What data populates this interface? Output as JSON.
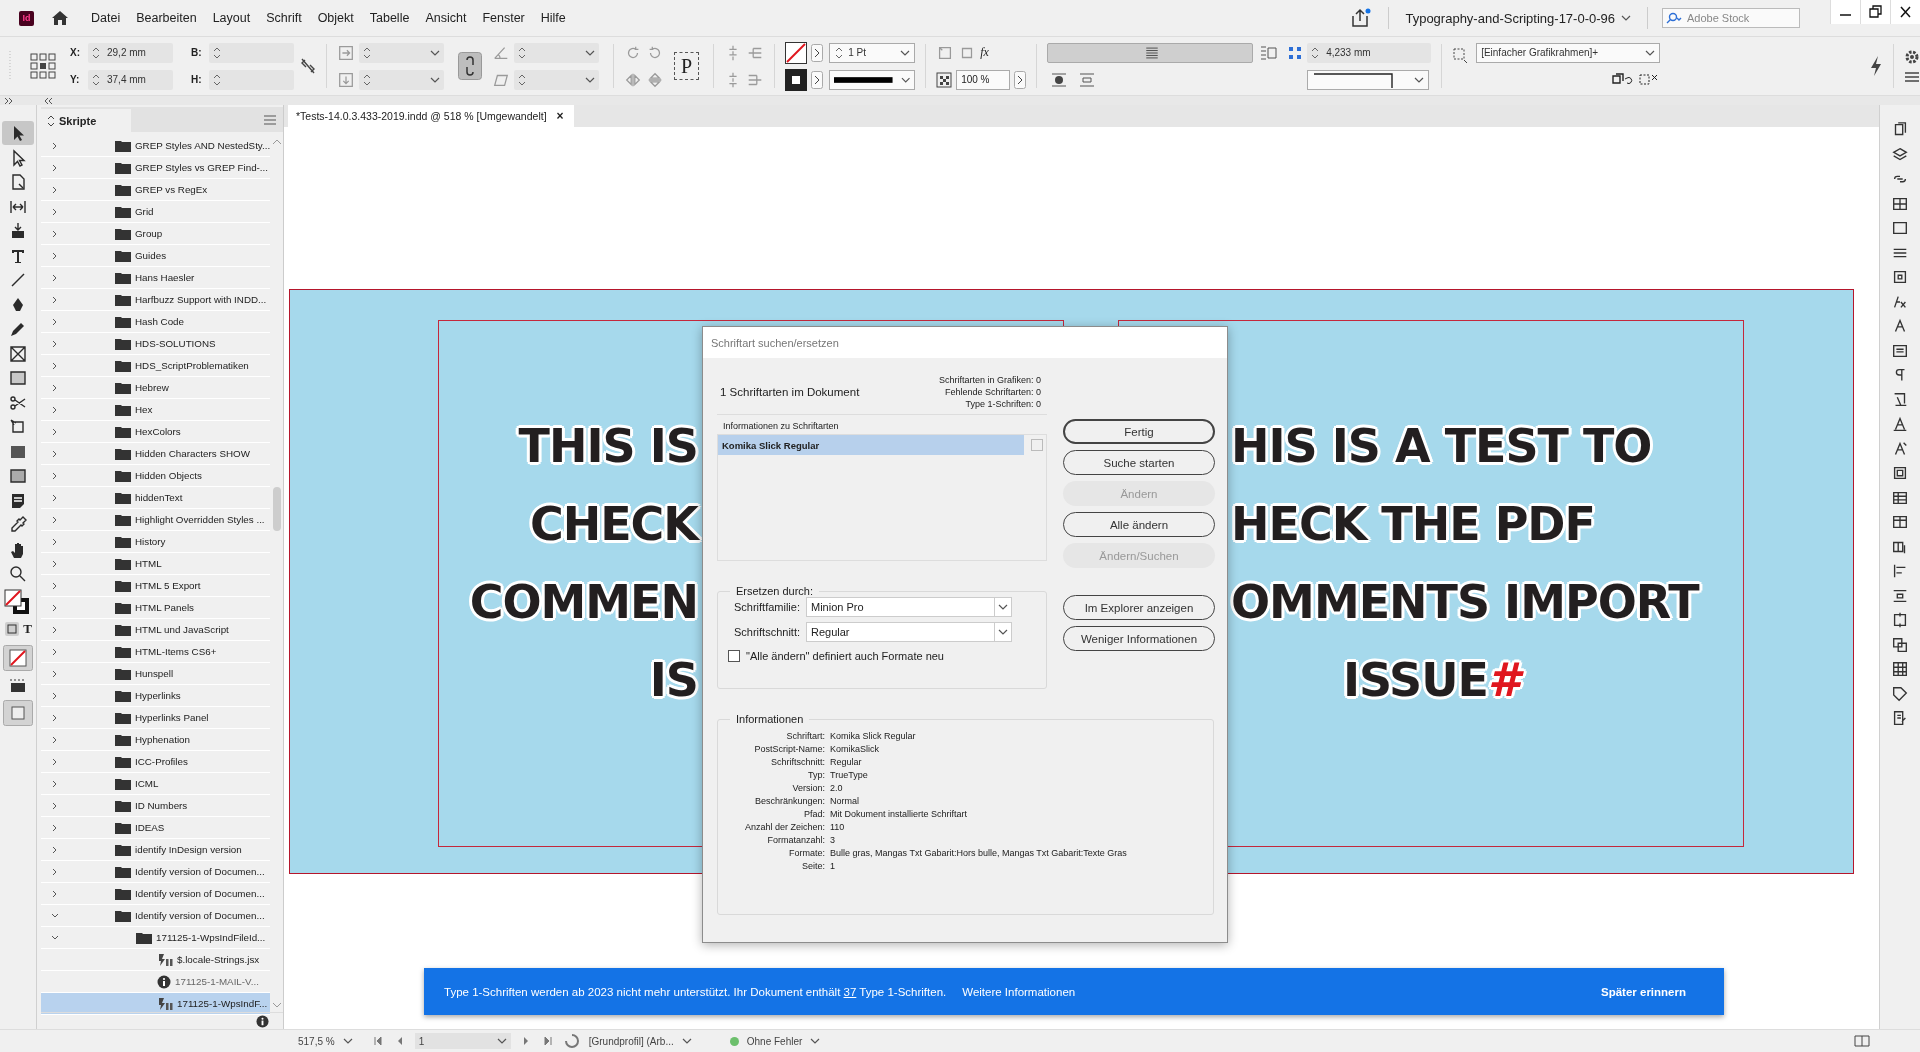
{
  "app": {
    "logo": "Id",
    "menus": [
      "Datei",
      "Bearbeiten",
      "Layout",
      "Schrift",
      "Objekt",
      "Tabelle",
      "Ansicht",
      "Fenster",
      "Hilfe"
    ],
    "document_title": "Typography-and-Scripting-17-0-0-96",
    "search": {
      "placeholder": "Adobe Stock"
    }
  },
  "control_bar": {
    "x_label": "X:",
    "x_value": "29,2 mm",
    "y_label": "Y:",
    "y_value": "37,4 mm",
    "w_label": "B:",
    "h_label": "H:",
    "p_button": "P",
    "stroke_weight": "1 Pt",
    "effects": "fx",
    "opacity": "100 %",
    "gap": "4,233 mm",
    "object_style": "[Einfacher Grafikrahmen]+"
  },
  "tools": [
    {
      "kind": "selection",
      "selected": true
    },
    {
      "kind": "direct",
      "selected": false
    },
    {
      "kind": "page",
      "selected": false
    },
    {
      "kind": "gap",
      "selected": false
    },
    {
      "kind": "collector",
      "selected": false
    },
    {
      "kind": "type",
      "selected": false
    },
    {
      "kind": "line",
      "selected": false
    },
    {
      "kind": "pen",
      "selected": false
    },
    {
      "kind": "pencil",
      "selected": false
    },
    {
      "kind": "frame",
      "selected": false
    },
    {
      "kind": "rect",
      "selected": false
    },
    {
      "kind": "scissors",
      "selected": false
    },
    {
      "kind": "transform",
      "selected": false
    },
    {
      "kind": "gradient",
      "selected": false
    },
    {
      "kind": "feather",
      "selected": false
    },
    {
      "kind": "note",
      "selected": false
    },
    {
      "kind": "eyedropper",
      "selected": false
    },
    {
      "kind": "hand",
      "selected": false
    },
    {
      "kind": "zoom",
      "selected": false
    }
  ],
  "format_toggle": {
    "text_label": "T"
  },
  "scripts_panel": {
    "title": "Skripte",
    "items": [
      {
        "label": "GREP Styles AND NestedSty...",
        "kind": "folder",
        "expanded": false,
        "selected": false
      },
      {
        "label": "GREP Styles vs GREP Find-...",
        "kind": "folder",
        "expanded": false,
        "selected": false
      },
      {
        "label": "GREP vs RegEx",
        "kind": "folder",
        "expanded": false,
        "selected": false
      },
      {
        "label": "Grid",
        "kind": "folder",
        "expanded": false,
        "selected": false
      },
      {
        "label": "Group",
        "kind": "folder",
        "expanded": false,
        "selected": false
      },
      {
        "label": "Guides",
        "kind": "folder",
        "expanded": false,
        "selected": false
      },
      {
        "label": "Hans Haesler",
        "kind": "folder",
        "expanded": false,
        "selected": false
      },
      {
        "label": "Harfbuzz Support with INDD...",
        "kind": "folder",
        "expanded": false,
        "selected": false
      },
      {
        "label": "Hash Code",
        "kind": "folder",
        "expanded": false,
        "selected": false
      },
      {
        "label": "HDS-SOLUTIONS",
        "kind": "folder",
        "expanded": false,
        "selected": false
      },
      {
        "label": "HDS_ScriptProblematiken",
        "kind": "folder",
        "expanded": false,
        "selected": false
      },
      {
        "label": "Hebrew",
        "kind": "folder",
        "expanded": false,
        "selected": false
      },
      {
        "label": "Hex",
        "kind": "folder",
        "expanded": false,
        "selected": false
      },
      {
        "label": "HexColors",
        "kind": "folder",
        "expanded": false,
        "selected": false
      },
      {
        "label": "Hidden Characters SHOW",
        "kind": "folder",
        "expanded": false,
        "selected": false
      },
      {
        "label": "Hidden Objects",
        "kind": "folder",
        "expanded": false,
        "selected": false
      },
      {
        "label": "hiddenText",
        "kind": "folder",
        "expanded": false,
        "selected": false
      },
      {
        "label": "Highlight Overridden Styles ...",
        "kind": "folder",
        "expanded": false,
        "selected": false
      },
      {
        "label": "History",
        "kind": "folder",
        "expanded": false,
        "selected": false
      },
      {
        "label": "HTML",
        "kind": "folder",
        "expanded": false,
        "selected": false
      },
      {
        "label": "HTML 5 Export",
        "kind": "folder",
        "expanded": false,
        "selected": false
      },
      {
        "label": "HTML Panels",
        "kind": "folder",
        "expanded": false,
        "selected": false
      },
      {
        "label": "HTML und JavaScript",
        "kind": "folder",
        "expanded": false,
        "selected": false
      },
      {
        "label": "HTML-Items CS6+",
        "kind": "folder",
        "expanded": false,
        "selected": false
      },
      {
        "label": "Hunspell",
        "kind": "folder",
        "expanded": false,
        "selected": false
      },
      {
        "label": "Hyperlinks",
        "kind": "folder",
        "expanded": false,
        "selected": false
      },
      {
        "label": "Hyperlinks Panel",
        "kind": "folder",
        "expanded": false,
        "selected": false
      },
      {
        "label": "Hyphenation",
        "kind": "folder",
        "expanded": false,
        "selected": false
      },
      {
        "label": "ICC-Profiles",
        "kind": "folder",
        "expanded": false,
        "selected": false
      },
      {
        "label": "ICML",
        "kind": "folder",
        "expanded": false,
        "selected": false
      },
      {
        "label": "ID Numbers",
        "kind": "folder",
        "expanded": false,
        "selected": false
      },
      {
        "label": "IDEAS",
        "kind": "folder",
        "expanded": false,
        "selected": false
      },
      {
        "label": "identify InDesign version",
        "kind": "folder",
        "expanded": false,
        "selected": false
      },
      {
        "label": "Identify version of Documen...",
        "kind": "folder",
        "expanded": false,
        "selected": false
      },
      {
        "label": "Identify version of Documen...",
        "kind": "folder",
        "expanded": false,
        "selected": false
      },
      {
        "label": "Identify version of Documen...",
        "kind": "folder",
        "expanded": true,
        "selected": false,
        "children": [
          {
            "label": "171125-1-WpsIndFileId...",
            "kind": "folder",
            "expanded": true,
            "selected": false,
            "children": [
              {
                "label": "$.locale-Strings.jsx",
                "kind": "script",
                "selected": false
              },
              {
                "label": "171125-1-MAIL-V...",
                "kind": "info",
                "selected": false
              },
              {
                "label": "171125-1-WpsIndF...",
                "kind": "script",
                "selected": true
              }
            ]
          }
        ]
      }
    ]
  },
  "document_tab": {
    "title": "*Tests-14.0.3.433-2019.indd @ 518 % [Umgewandelt]",
    "close": "×"
  },
  "canvas": {
    "left_frame": {
      "lines": [
        "THIS IS",
        "CHECK",
        "COMMEN",
        "IS"
      ]
    },
    "right_frame": {
      "lines": [
        "HIS IS A TEST TO",
        "HECK THE PDF",
        "OMMENTS IMPORT",
        "ISSUE"
      ],
      "end_mark": "#"
    }
  },
  "dialog": {
    "title": "Schriftart suchen/ersetzen",
    "summary": "1 Schriftarten im Dokument",
    "stats": [
      {
        "label": "Schriftarten in Grafiken:",
        "value": "0"
      },
      {
        "label": "Fehlende Schriftarten:",
        "value": "0"
      },
      {
        "label": "Type 1-Schriften:",
        "value": "0"
      }
    ],
    "list_label": "Informationen zu Schriftarten",
    "fonts": [
      {
        "name": "Komika Slick Regular",
        "selected": true,
        "checked": false
      }
    ],
    "buttons": [
      {
        "label": "Fertig",
        "kind": "default",
        "disabled": false
      },
      {
        "label": "Suche starten",
        "kind": "normal",
        "disabled": false
      },
      {
        "label": "Ändern",
        "kind": "normal",
        "disabled": true
      },
      {
        "label": "Alle ändern",
        "kind": "normal",
        "disabled": false
      },
      {
        "label": "Ändern/Suchen",
        "kind": "normal",
        "disabled": true
      }
    ],
    "extra_buttons": [
      {
        "label": "Im Explorer anzeigen",
        "disabled": false
      },
      {
        "label": "Weniger Informationen",
        "disabled": false
      }
    ],
    "replace": {
      "legend": "Ersetzen durch:",
      "family_label": "Schriftfamilie:",
      "family": "Minion Pro",
      "style_label": "Schriftschnitt:",
      "style": "Regular",
      "redefine": {
        "label": "\"Alle ändern\" definiert auch Formate neu",
        "checked": false
      }
    },
    "info": {
      "legend": "Informationen",
      "rows": [
        {
          "label": "Schriftart:",
          "value": "Komika Slick Regular"
        },
        {
          "label": "PostScript-Name:",
          "value": "KomikaSlick"
        },
        {
          "label": "Schriftschnitt:",
          "value": "Regular"
        },
        {
          "label": "Typ:",
          "value": "TrueType"
        },
        {
          "label": "Version:",
          "value": "2.0"
        },
        {
          "label": "Beschränkungen:",
          "value": "Normal"
        },
        {
          "label": "Pfad:",
          "value": "Mit Dokument installierte Schriftart"
        },
        {
          "label": "Anzahl der Zeichen:",
          "value": "110"
        },
        {
          "label": "Formatanzahl:",
          "value": "3"
        },
        {
          "label": "Formate:",
          "value": "Bulle gras, Mangas Txt Gabarit:Hors bulle, Mangas Txt Gabarit:Texte Gras"
        },
        {
          "label": "Seite:",
          "value": "1"
        }
      ]
    }
  },
  "notification": {
    "before": "Type 1-Schriften werden ab 2023 nicht mehr unterstützt. Ihr Dokument enthält ",
    "count": "37",
    "after": " Type 1-Schriften.",
    "link": "Weitere Informationen",
    "dismiss": "Später erinnern"
  },
  "status_bar": {
    "zoom": "517,5 %",
    "page": "1",
    "profile": "[Grundprofil] (Arb...",
    "preflight": {
      "label": "Ohne Fehler",
      "color": "#6cbf6c"
    }
  }
}
